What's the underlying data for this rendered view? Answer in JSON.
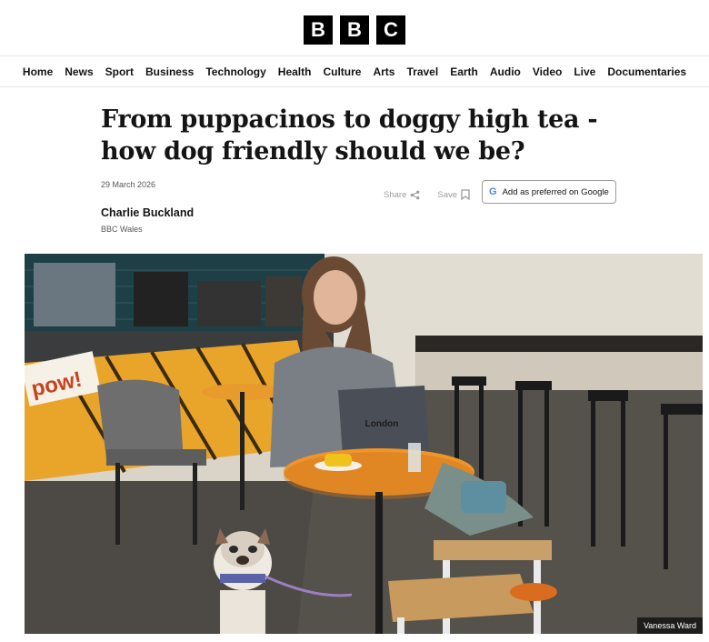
{
  "logo": {
    "letters": [
      "B",
      "B",
      "C"
    ]
  },
  "nav": {
    "items": [
      "Home",
      "News",
      "Sport",
      "Business",
      "Technology",
      "Health",
      "Culture",
      "Arts",
      "Travel",
      "Earth",
      "Audio",
      "Video",
      "Live",
      "Documentaries"
    ]
  },
  "article": {
    "headline": "From puppacinos to doggy high tea - how dog friendly should we be?",
    "date": "29 March 2026",
    "author": "Charlie Buckland",
    "organisation": "BBC Wales"
  },
  "actions": {
    "share_label": "Share",
    "save_label": "Save",
    "preferred_label": "Add as preferred on Google",
    "share_icon": "share-icon",
    "save_icon": "bookmark-icon",
    "google_icon": "google-g-icon"
  },
  "image": {
    "credit": "Vanessa Ward",
    "laptop_text": "London",
    "sign_text": "pow!"
  },
  "colors": {
    "brand": "#000000",
    "text": "#141414",
    "muted": "#545658",
    "action_grey": "#9c9c9c"
  }
}
